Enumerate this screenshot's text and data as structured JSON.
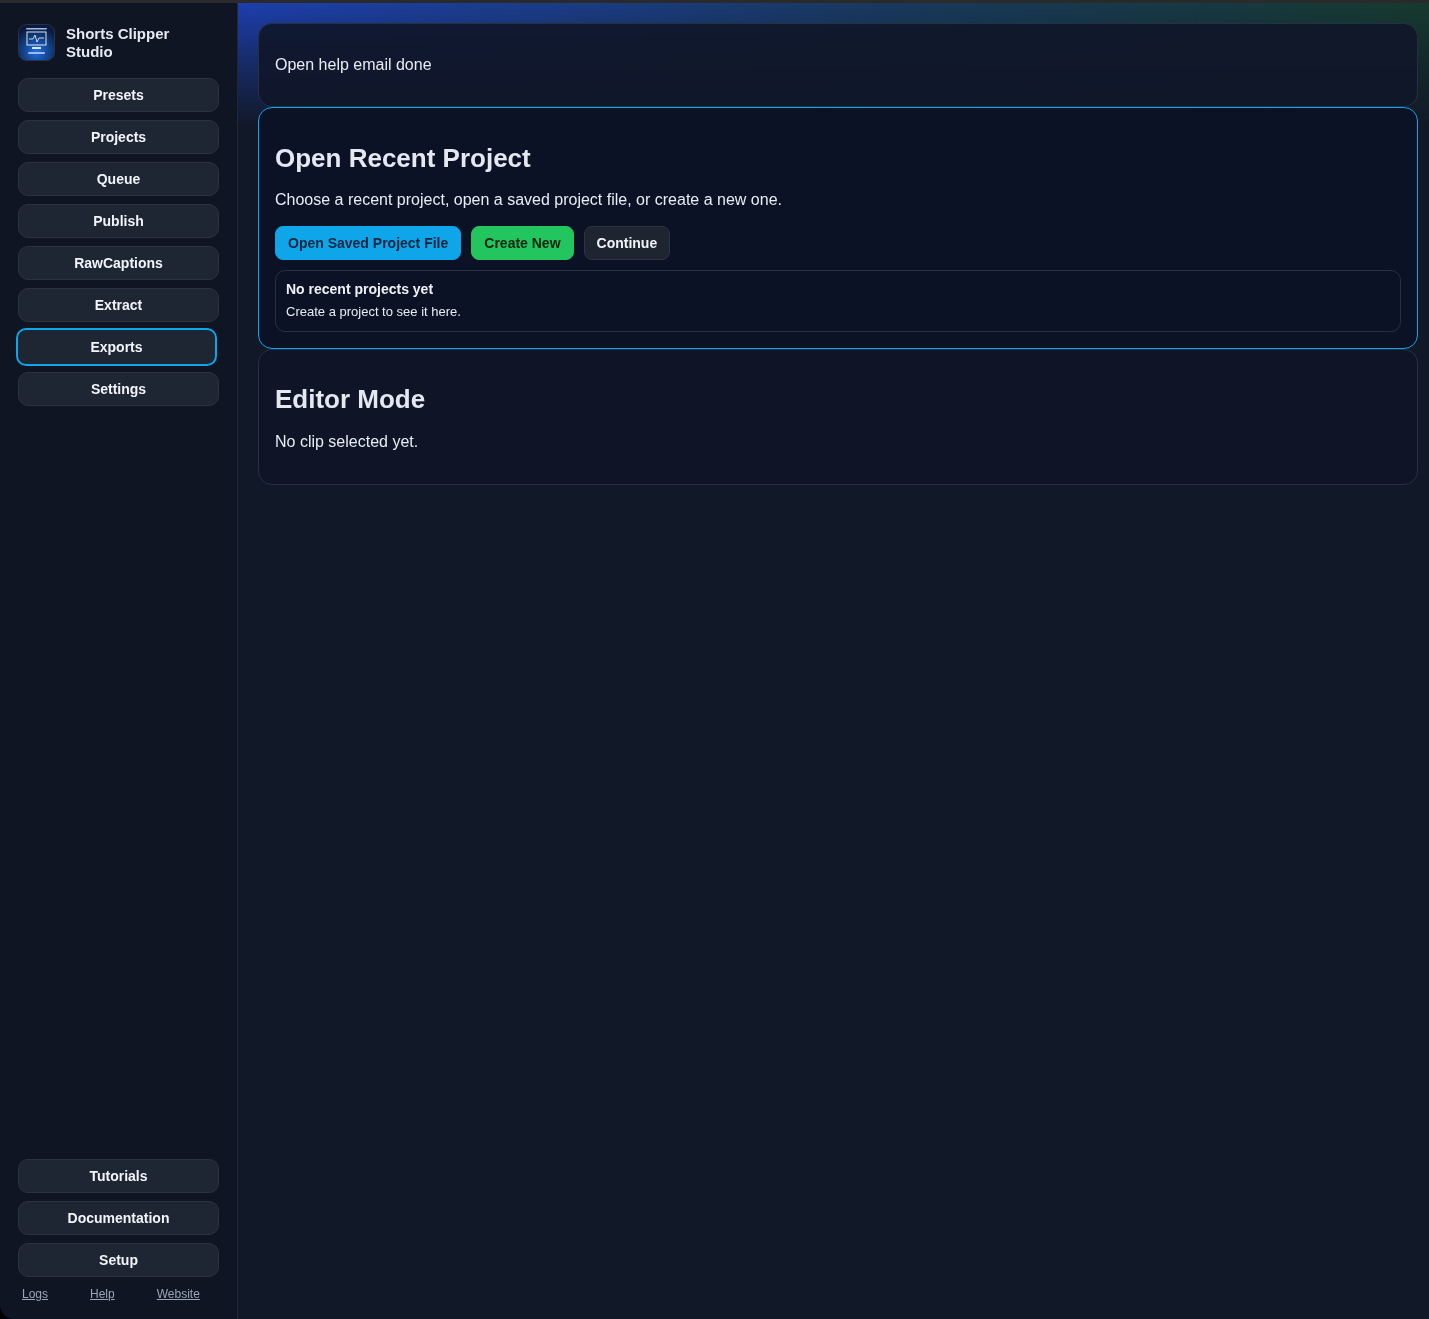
{
  "app": {
    "title": "Shorts Clipper Studio"
  },
  "sidebar": {
    "nav": [
      {
        "label": "Presets",
        "selected": false
      },
      {
        "label": "Projects",
        "selected": false
      },
      {
        "label": "Queue",
        "selected": false
      },
      {
        "label": "Publish",
        "selected": false
      },
      {
        "label": "RawCaptions",
        "selected": false
      },
      {
        "label": "Extract",
        "selected": false
      },
      {
        "label": "Exports",
        "selected": true
      },
      {
        "label": "Settings",
        "selected": false
      }
    ],
    "footer_buttons": [
      "Tutorials",
      "Documentation",
      "Setup"
    ],
    "links": [
      "Logs",
      "Help",
      "Website"
    ]
  },
  "status_message": {
    "text": "Open help email done"
  },
  "recent_project_panel": {
    "title": "Open Recent Project",
    "description": "Choose a recent project, open a saved project file, or create a new one.",
    "focused": true,
    "actions": [
      {
        "label": "Open Saved Project File",
        "kind": "primary"
      },
      {
        "label": "Create New",
        "kind": "success"
      },
      {
        "label": "Continue",
        "kind": "secondary"
      }
    ],
    "empty_state": {
      "title": "No recent projects yet",
      "message": "Create a project to see it here."
    }
  },
  "editor_panel": {
    "title": "Editor Mode",
    "message": "No clip selected yet."
  }
}
